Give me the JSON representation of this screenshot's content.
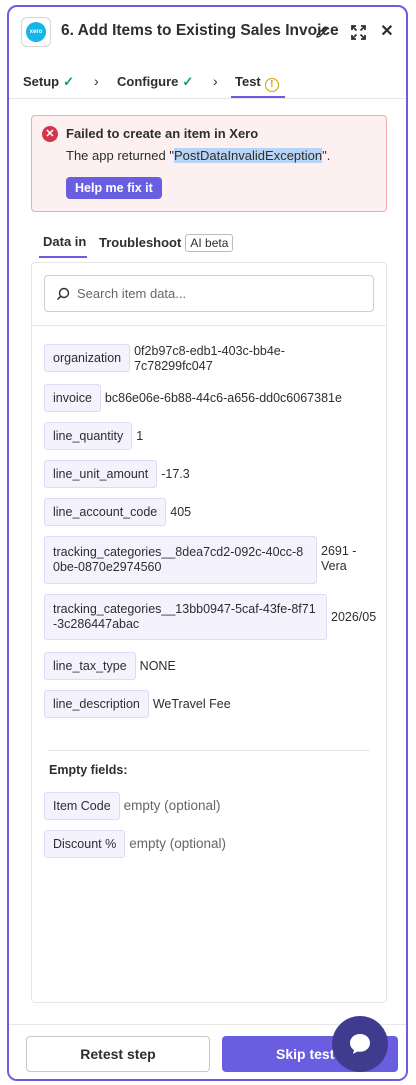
{
  "header": {
    "title": "6. Add Items to Existing Sales Invoice",
    "logo_text": "xero"
  },
  "steps": {
    "setup": "Setup",
    "configure": "Configure",
    "test": "Test"
  },
  "error": {
    "title": "Failed to create an item in Xero",
    "message_prefix": "The app returned \"",
    "message_highlight": "PostDataInvalidException",
    "message_suffix": "\".",
    "help_button": "Help me fix it"
  },
  "tabs": {
    "data_in": "Data in",
    "troubleshoot": "Troubleshoot",
    "ai_badge": "AI beta"
  },
  "search": {
    "placeholder": "Search item data..."
  },
  "fields": [
    {
      "key": "organization",
      "value": "0f2b97c8-edb1-403c-bb4e-7c78299fc047"
    },
    {
      "key": "invoice",
      "value": "bc86e06e-6b88-44c6-a656-dd0c6067381e"
    },
    {
      "key": "line_quantity",
      "value": "1"
    },
    {
      "key": "line_unit_amount",
      "value": "-17.3"
    },
    {
      "key": "line_account_code",
      "value": "405"
    },
    {
      "key": "tracking_categories__8dea7cd2-092c-40cc-80be-0870e2974560",
      "value": "2691 - Vera"
    },
    {
      "key": "tracking_categories__13bb0947-5caf-43fe-8f71-3c286447abac",
      "value": "2026/05"
    },
    {
      "key": "line_tax_type",
      "value": "NONE"
    },
    {
      "key": "line_description",
      "value": "WeTravel Fee"
    }
  ],
  "empty_fields": {
    "title": "Empty fields:",
    "items": [
      {
        "key": "Item Code",
        "value": "empty (optional)"
      },
      {
        "key": "Discount %",
        "value": "empty (optional)"
      }
    ]
  },
  "footer": {
    "retest": "Retest step",
    "skip": "Skip test"
  },
  "colors": {
    "accent": "#6a5ee0",
    "error_bg": "#fdf0f0",
    "error_border": "#f0a9ae",
    "success": "#12a154",
    "warning": "#d69e00"
  }
}
